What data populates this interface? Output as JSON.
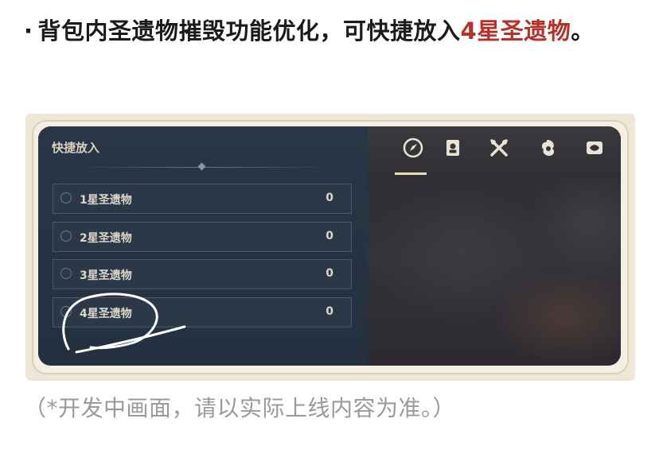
{
  "headline": {
    "bullet": "·",
    "text": "背包内圣遗物摧毁功能优化，可快捷放入",
    "accent": "4星圣遗物",
    "end": "。"
  },
  "game_ui": {
    "panel_title": "快捷放入",
    "items": [
      {
        "label": "1星圣遗物",
        "count": "0"
      },
      {
        "label": "2星圣遗物",
        "count": "0"
      },
      {
        "label": "3星圣遗物",
        "count": "0"
      },
      {
        "label": "4星圣遗物",
        "count": "0"
      }
    ],
    "tabs": [
      "compass-icon",
      "character-card-icon",
      "crossed-utensils-icon",
      "flower-swirl-icon",
      "material-scroll-icon",
      "quest-book-icon"
    ]
  },
  "caption": "（*开发中画面，请以实际上线内容为准。）",
  "colors": {
    "accent": "#b4322a",
    "panel": "#283647",
    "highlight_circle": "#ffffff"
  }
}
